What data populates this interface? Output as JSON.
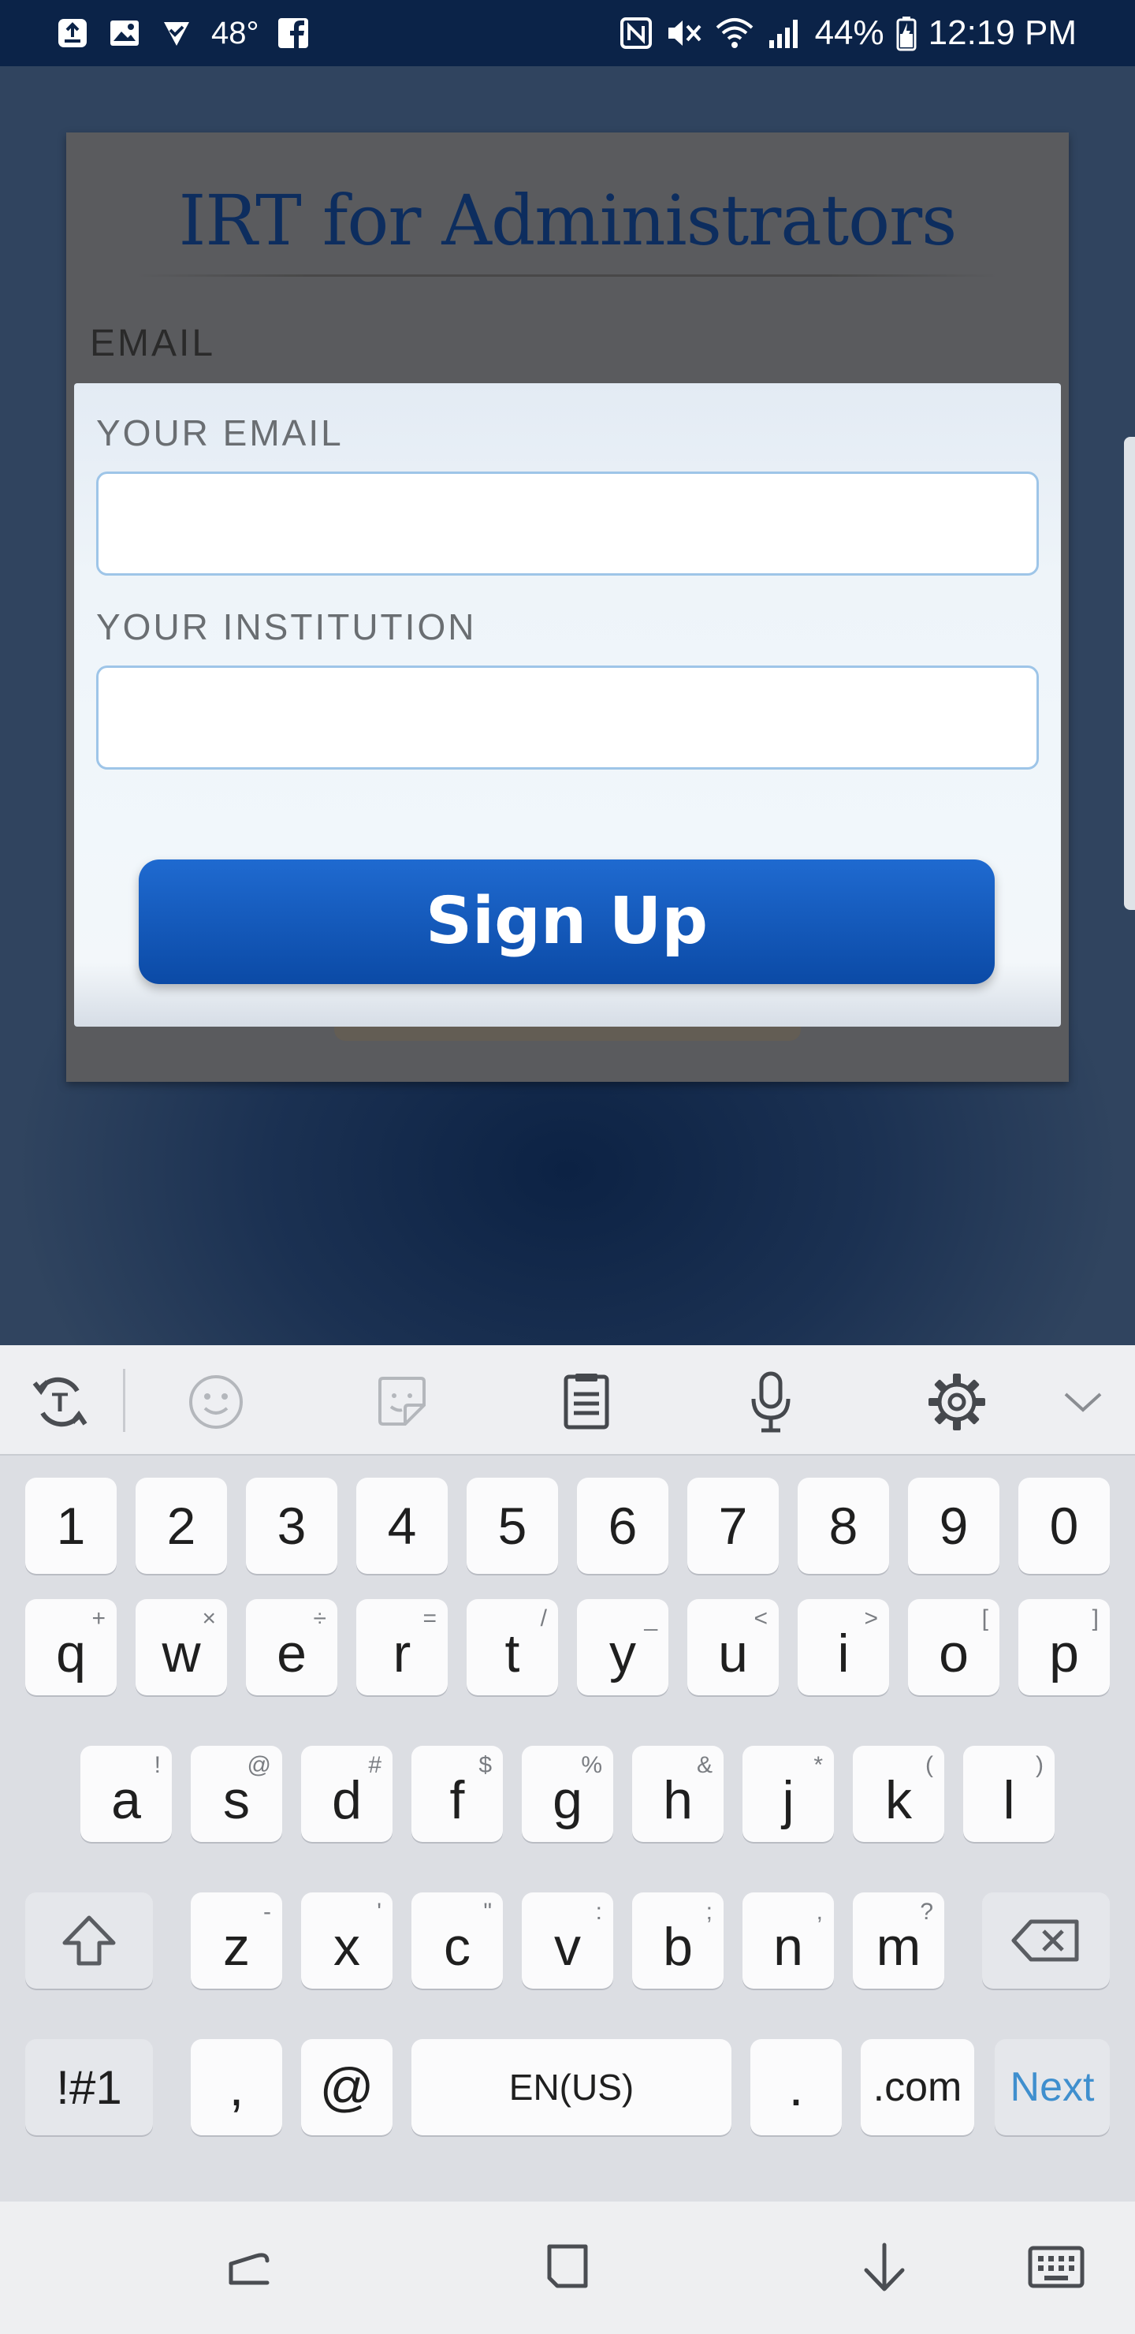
{
  "status_bar": {
    "temperature": "48°",
    "battery": "44%",
    "time": "12:19 PM",
    "left_icons": [
      "upload-notification-icon",
      "gallery-icon",
      "download-check-icon",
      "weather-temp",
      "facebook-icon"
    ],
    "right_icons": [
      "nfc-icon",
      "mute-icon",
      "wifi-icon",
      "signal-icon",
      "battery-icon"
    ]
  },
  "login_card": {
    "title": "IRT for Administrators",
    "email_label": "EMAIL"
  },
  "signup": {
    "email_label": "YOUR EMAIL",
    "email_value": "",
    "institution_label": "YOUR INSTITUTION",
    "institution_value": "",
    "button_label": "Sign Up"
  },
  "keyboard": {
    "toolbar": [
      "text-mode-icon",
      "emoji-icon",
      "sticker-icon",
      "clipboard-icon",
      "microphone-icon",
      "settings-gear-icon",
      "collapse-chevron-icon"
    ],
    "number_row": [
      "1",
      "2",
      "3",
      "4",
      "5",
      "6",
      "7",
      "8",
      "9",
      "0"
    ],
    "row1": {
      "keys": [
        "q",
        "w",
        "e",
        "r",
        "t",
        "y",
        "u",
        "i",
        "o",
        "p"
      ],
      "alts": [
        "+",
        "×",
        "÷",
        "=",
        "/",
        "_",
        "<",
        ">",
        "[",
        "]"
      ]
    },
    "row2": {
      "keys": [
        "a",
        "s",
        "d",
        "f",
        "g",
        "h",
        "j",
        "k",
        "l"
      ],
      "alts": [
        "!",
        "@",
        "#",
        "$",
        "%",
        "&",
        "*",
        "(",
        ")"
      ]
    },
    "row3": {
      "keys": [
        "z",
        "x",
        "c",
        "v",
        "b",
        "n",
        "m"
      ],
      "alts": [
        "-",
        "'",
        "\"",
        ":",
        ";",
        ",",
        "?"
      ]
    },
    "bottom_row": {
      "symbols": "!#1",
      "comma": ",",
      "at": "@",
      "space": "EN(US)",
      "period": ".",
      "dotcom": ".com",
      "next": "Next"
    },
    "accent_color": "#3f8fce"
  },
  "nav_bar": [
    "recents-icon",
    "home-icon",
    "hide-keyboard-icon",
    "keyboard-switch-icon"
  ],
  "colors": {
    "status_bar": "#0b2348",
    "title": "#0d2d5e",
    "signup_button": "#1158b8",
    "input_border": "#9ec5e8"
  }
}
